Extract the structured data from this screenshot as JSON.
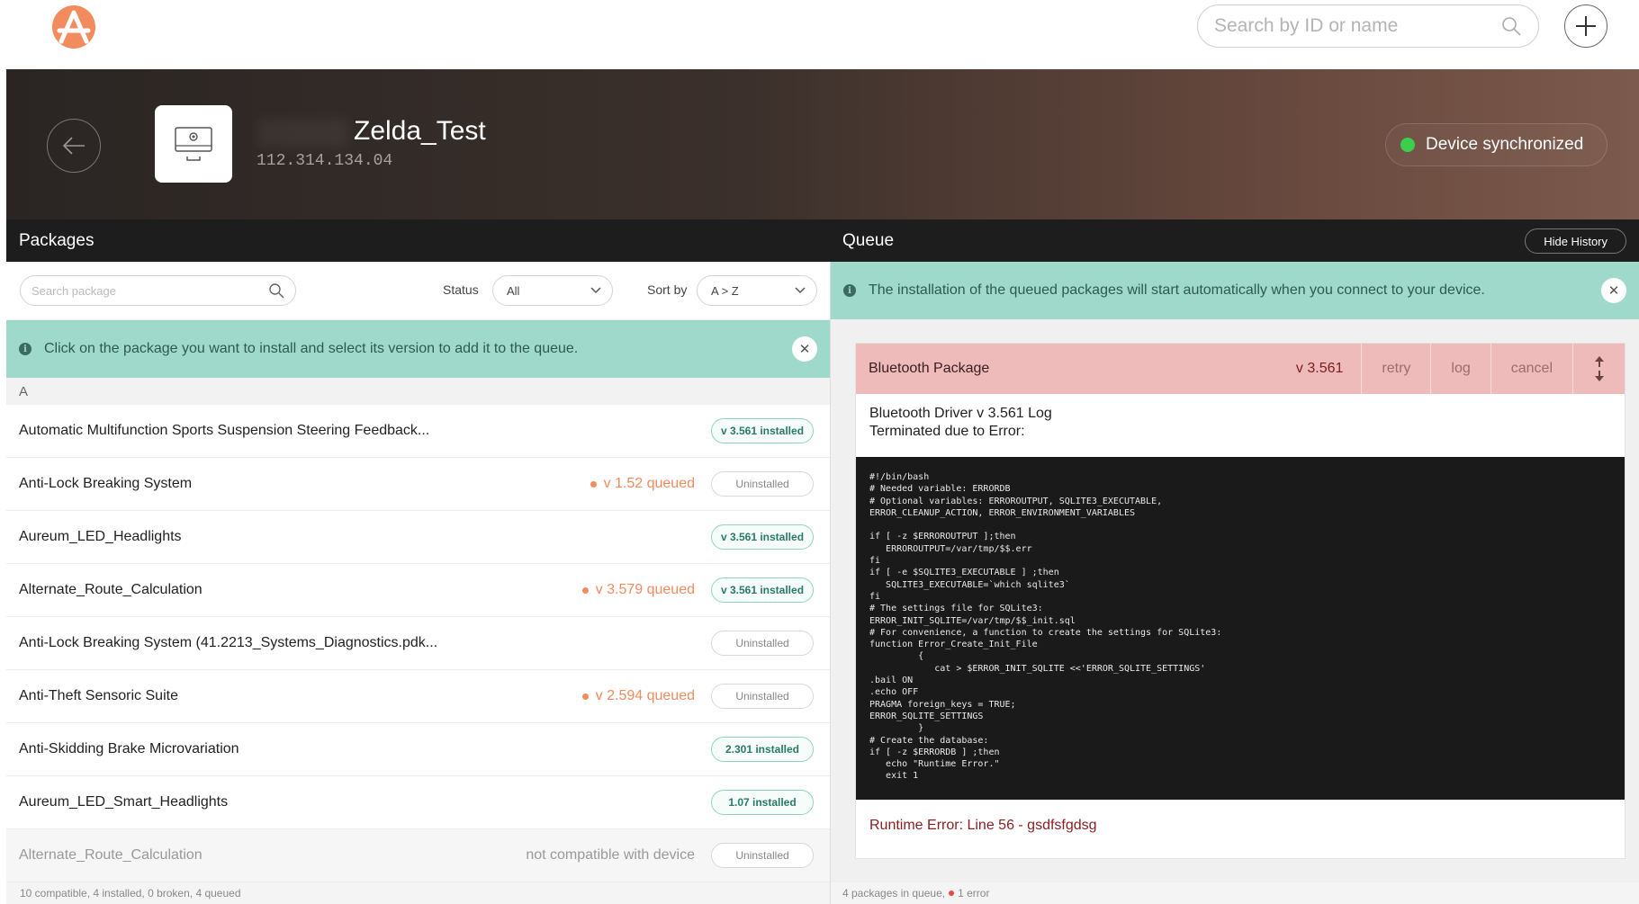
{
  "app": {
    "logo_letter": "A",
    "search_placeholder": "Search by ID or name"
  },
  "device": {
    "name": "Zelda_Test",
    "ip": "112.314.134.04",
    "status": "Device synchronized"
  },
  "packages": {
    "title": "Packages",
    "search_placeholder": "Search package",
    "status_label": "Status",
    "status_value": "All",
    "sort_label": "Sort by",
    "sort_value": "A > Z",
    "info_text": "Click on the package you want to install and select its version to add it to the queue.",
    "group_letter": "A",
    "rows": [
      {
        "name": "Automatic Multifunction Sports Suspension Steering Feedback...",
        "queued": "",
        "badge": "v 3.561 installed",
        "badge_type": "installed"
      },
      {
        "name": "Anti-Lock Breaking System",
        "queued": "v 1.52 queued",
        "badge": "Uninstalled",
        "badge_type": "uninstalled"
      },
      {
        "name": "Aureum_LED_Headlights",
        "queued": "",
        "badge": "v 3.561 installed",
        "badge_type": "installed"
      },
      {
        "name": "Alternate_Route_Calculation",
        "queued": "v 3.579 queued",
        "badge": "v 3.561 installed",
        "badge_type": "installed"
      },
      {
        "name": "Anti-Lock Breaking System (41.2213_Systems_Diagnostics.pdk...",
        "queued": "",
        "badge": "Uninstalled",
        "badge_type": "uninstalled"
      },
      {
        "name": "Anti-Theft Sensoric Suite",
        "queued": "v 2.594 queued",
        "badge": "Uninstalled",
        "badge_type": "uninstalled"
      },
      {
        "name": "Anti-Skidding Brake Microvariation",
        "queued": "",
        "badge": "2.301 installed",
        "badge_type": "installed"
      },
      {
        "name": "Aureum_LED_Smart_Headlights",
        "queued": "",
        "badge": "1.07 installed",
        "badge_type": "installed"
      },
      {
        "name": "Alternate_Route_Calculation",
        "queued": "",
        "notcompat": "not compatible with device",
        "badge": "Uninstalled",
        "badge_type": "uninstalled",
        "disabled": true
      }
    ],
    "footer": "10 compatible, 4 installed, 0 broken, 4 queued"
  },
  "queue": {
    "title": "Queue",
    "hide_history": "Hide History",
    "info_text": "The installation of the queued packages will start automatically when you connect to your device.",
    "item": {
      "name": "Bluetooth Package",
      "version": "v 3.561",
      "retry": "retry",
      "log": "log",
      "cancel": "cancel"
    },
    "log_title_line1": "Bluetooth Driver v 3.561 Log",
    "log_title_line2": "Terminated due to Error:",
    "log_code": "#!/bin/bash\n# Needed variable: ERRORDB\n# Optional variables: ERROROUTPUT, SQLITE3_EXECUTABLE,\nERROR_CLEANUP_ACTION, ERROR_ENVIRONMENT_VARIABLES\n\nif [ -z $ERROROUTPUT ];then\n   ERROROUTPUT=/var/tmp/$$.err\nfi\nif [ -e $SQLITE3_EXECUTABLE ] ;then\n   SQLITE3_EXECUTABLE=`which sqlite3`\nfi\n# The settings file for SQLite3:\nERROR_INIT_SQLITE=/var/tmp/$$_init.sql\n# For convenience, a function to create the settings for SQLite3:\nfunction Error_Create_Init_File\n         {\n            cat > $ERROR_INIT_SQLITE <<'ERROR_SQLITE_SETTINGS'\n.bail ON\n.echo OFF\nPRAGMA foreign_keys = TRUE;\nERROR_SQLITE_SETTINGS\n         }\n# Create the database:\nif [ -z $ERRORDB ] ;then\n   echo \"Runtime Error.\"\n   exit 1",
    "runtime_error": "Runtime Error: Line 56 - gsdfsfgdsg",
    "footer_count": "4 packages in queue,",
    "footer_error": "1 error"
  },
  "colors": {
    "accent": "#f28b5e",
    "info_bg": "#9fd9cc",
    "error_bg": "#eebaba",
    "sync_green": "#3ccf4e"
  }
}
